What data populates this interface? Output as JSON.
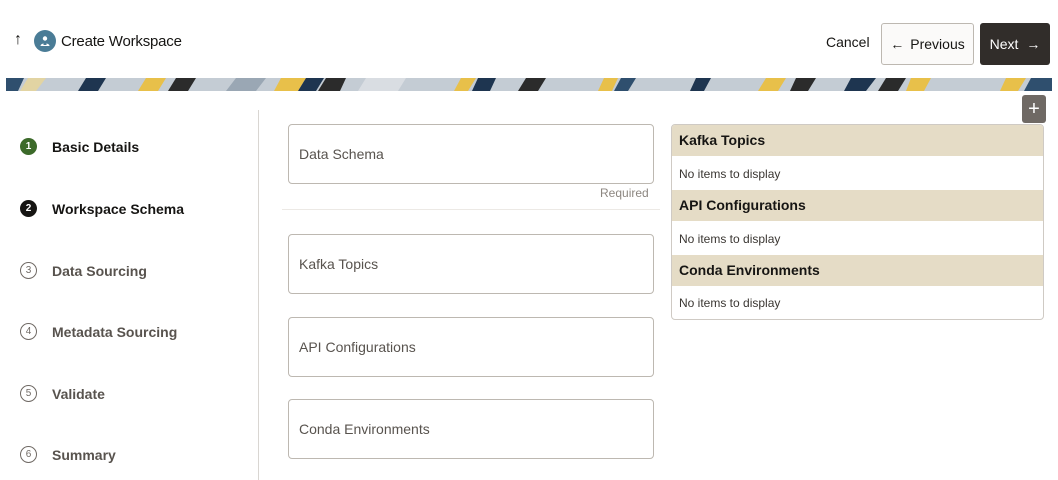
{
  "header": {
    "title": "Create Workspace",
    "back_icon": "up-arrow-icon",
    "app_icon": "workspace-icon",
    "cancel_label": "Cancel",
    "previous_label": "Previous",
    "next_label": "Next"
  },
  "stepper": {
    "steps": [
      {
        "number": "1",
        "label": "Basic Details",
        "state": "completed"
      },
      {
        "number": "2",
        "label": "Workspace Schema",
        "state": "current"
      },
      {
        "number": "3",
        "label": "Data Sourcing",
        "state": "pending"
      },
      {
        "number": "4",
        "label": "Metadata Sourcing",
        "state": "pending"
      },
      {
        "number": "5",
        "label": "Validate",
        "state": "pending"
      },
      {
        "number": "6",
        "label": "Summary",
        "state": "pending"
      }
    ]
  },
  "form": {
    "data_schema": {
      "label": "Data Schema",
      "required_text": "Required"
    },
    "kafka_topics": {
      "label": "Kafka Topics"
    },
    "api_configurations": {
      "label": "API Configurations"
    },
    "conda_environments": {
      "label": "Conda Environments"
    }
  },
  "summary_panel": {
    "add_icon": "plus-icon",
    "sections": [
      {
        "title": "Kafka Topics",
        "empty_text": "No items to display"
      },
      {
        "title": "API Configurations",
        "empty_text": "No items to display"
      },
      {
        "title": "Conda Environments",
        "empty_text": "No items to display"
      }
    ]
  },
  "colors": {
    "primary_button": "#312d2a",
    "completed_step": "#3c6a2a",
    "section_header": "#e5dcc6"
  }
}
